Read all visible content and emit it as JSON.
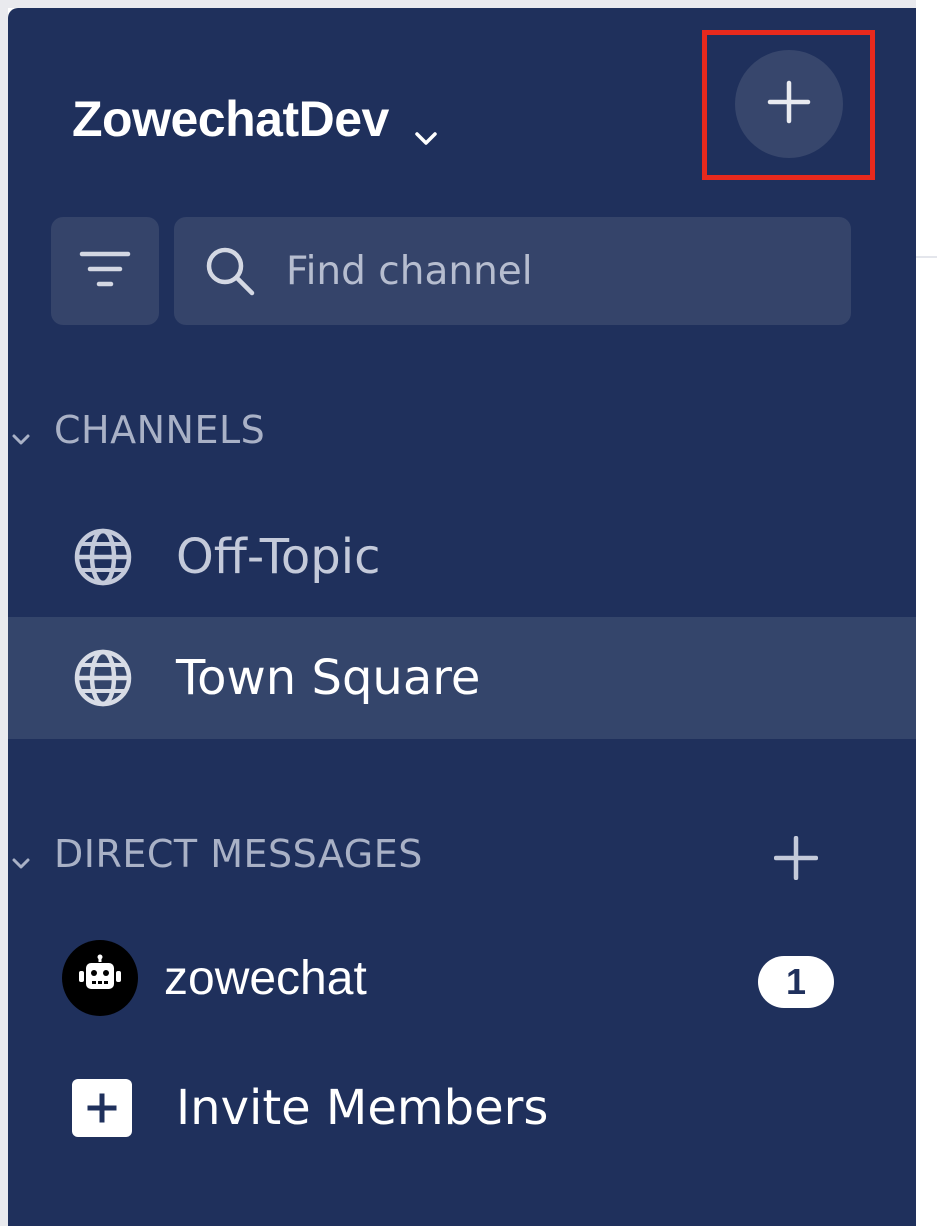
{
  "header": {
    "team_name": "ZowechatDev",
    "add_team_icon": "plus-icon",
    "team_menu_icon": "chevron-down-icon"
  },
  "search": {
    "placeholder": "Find channel",
    "value": "",
    "filter_icon": "filter-icon",
    "search_icon": "search-icon"
  },
  "sections": {
    "channels": {
      "label": "CHANNELS",
      "items": [
        {
          "label": "Off-Topic",
          "icon": "globe-icon",
          "active": false
        },
        {
          "label": "Town Square",
          "icon": "globe-icon",
          "active": true
        }
      ]
    },
    "direct_messages": {
      "label": "DIRECT MESSAGES",
      "add_icon": "plus-icon",
      "items": [
        {
          "label": "zowechat",
          "avatar": "robot-icon",
          "unread": "1"
        }
      ]
    }
  },
  "invite": {
    "label": "Invite Members",
    "icon": "plus-square-icon"
  },
  "colors": {
    "sidebar_bg": "#1f305c",
    "active_item_bg": "#34456b",
    "highlight_box": "#e8291d",
    "muted_text": "#a9b1c6"
  }
}
